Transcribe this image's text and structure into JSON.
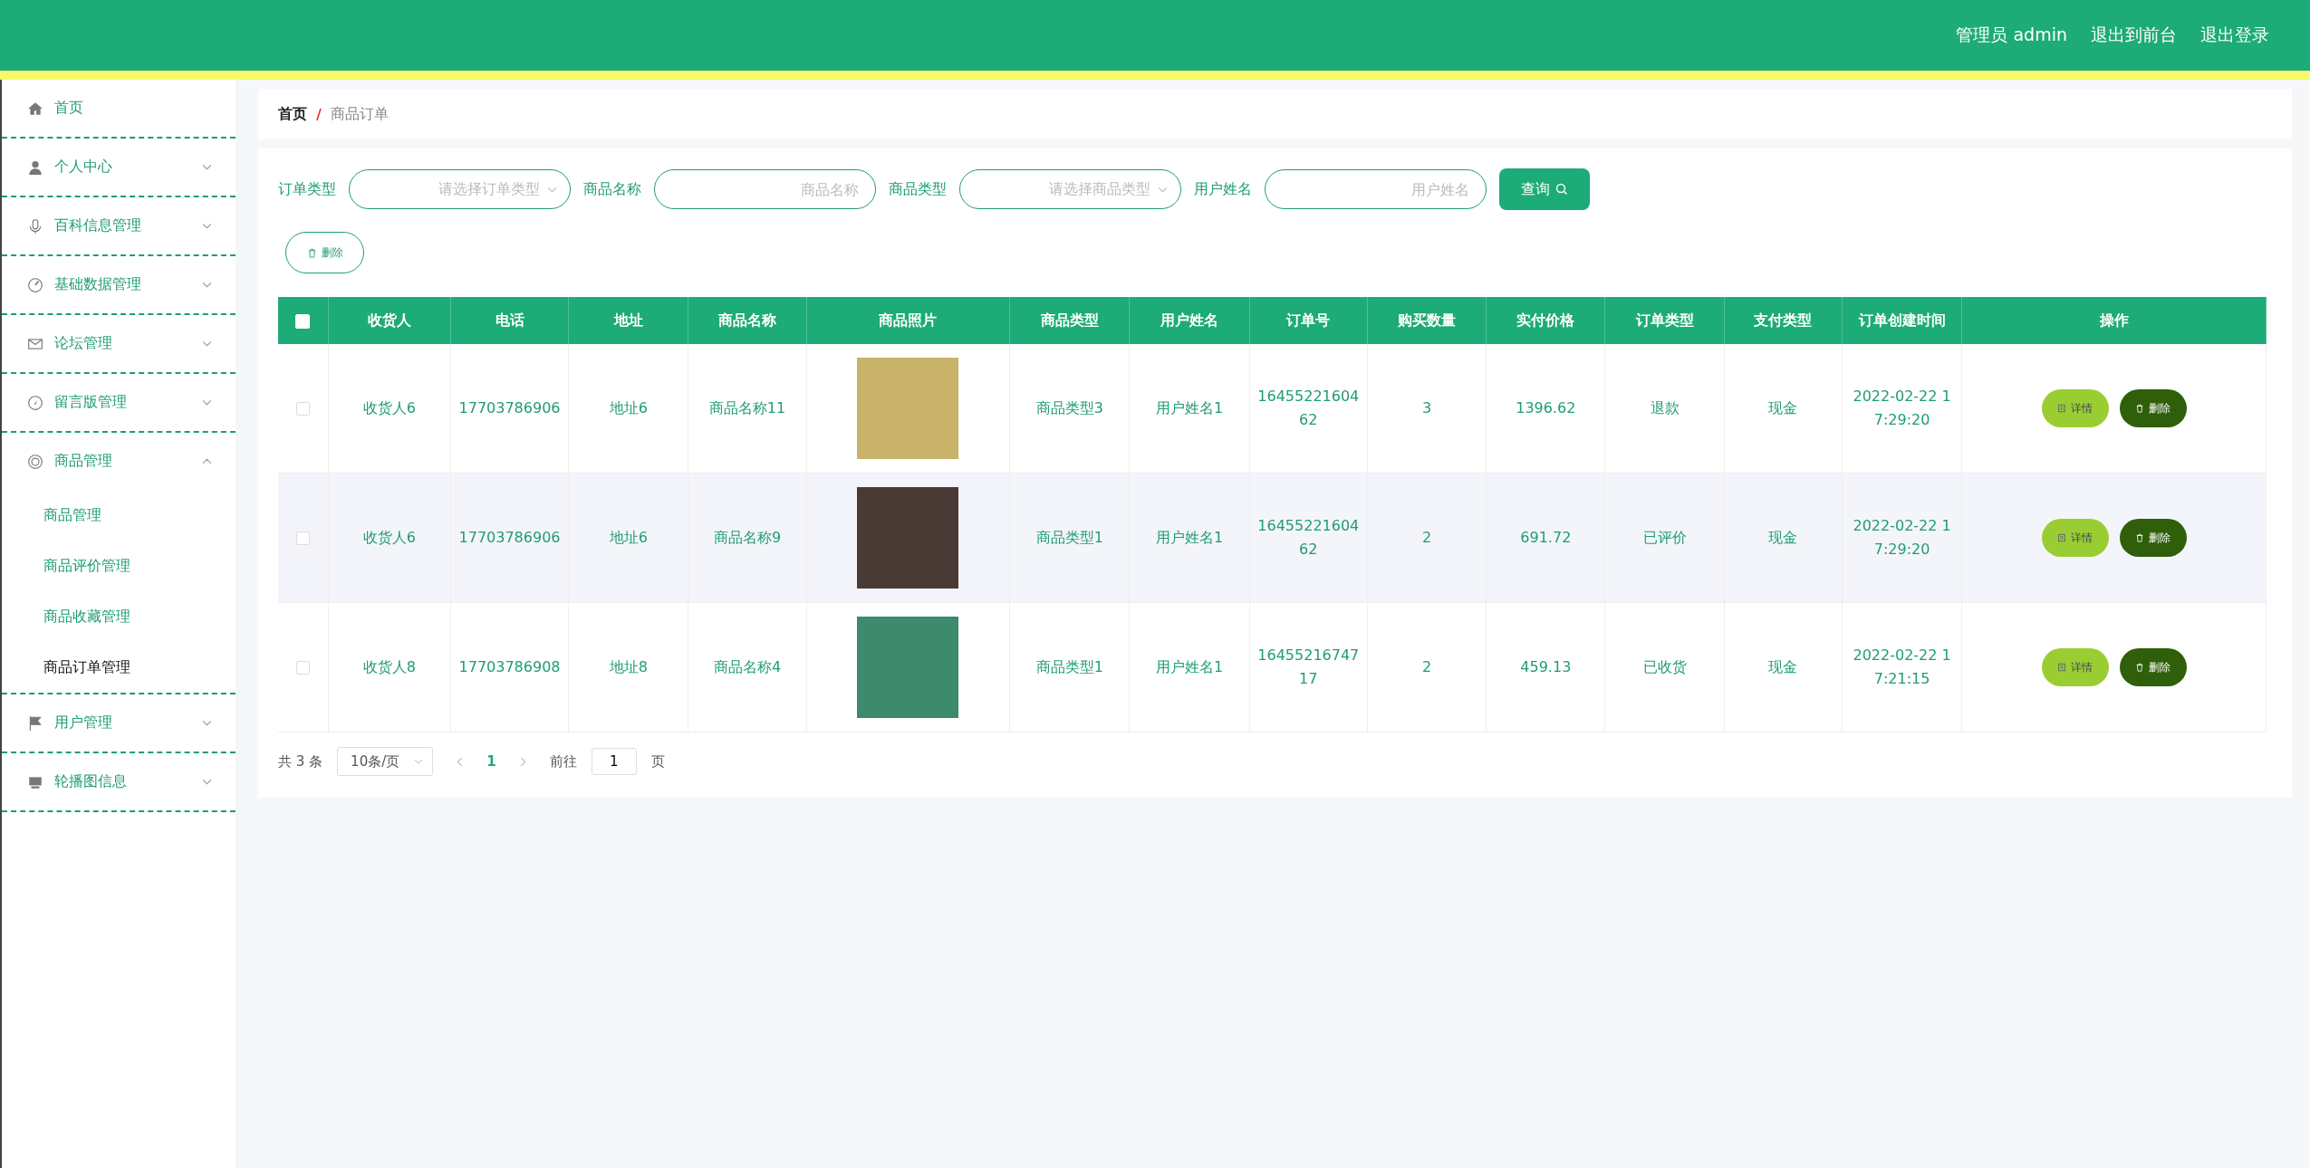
{
  "header": {
    "links": [
      "管理员 admin",
      "退出到前台",
      "退出登录"
    ]
  },
  "sidebar": {
    "items": [
      {
        "label": "首页"
      },
      {
        "label": "个人中心",
        "expanded": false
      },
      {
        "label": "百科信息管理",
        "expanded": false
      },
      {
        "label": "基础数据管理",
        "expanded": false
      },
      {
        "label": "论坛管理",
        "expanded": false
      },
      {
        "label": "留言版管理",
        "expanded": false
      },
      {
        "label": "商品管理",
        "expanded": true,
        "children": [
          {
            "label": "商品管理",
            "selected": false
          },
          {
            "label": "商品评价管理",
            "selected": false
          },
          {
            "label": "商品收藏管理",
            "selected": false
          },
          {
            "label": "商品订单管理",
            "selected": true
          }
        ]
      },
      {
        "label": "用户管理",
        "expanded": false
      },
      {
        "label": "轮播图信息",
        "expanded": false
      }
    ]
  },
  "breadcrumb": {
    "items": [
      "首页",
      "商品订单"
    ],
    "separator": "/"
  },
  "search": {
    "fields": [
      {
        "kind": "select",
        "label": "订单类型",
        "placeholder": "请选择订单类型"
      },
      {
        "kind": "input",
        "label": "商品名称",
        "placeholder": "商品名称"
      },
      {
        "kind": "select",
        "label": "商品类型",
        "placeholder": "请选择商品类型"
      },
      {
        "kind": "input",
        "label": "用户姓名",
        "placeholder": "用户姓名"
      }
    ],
    "button": "查询"
  },
  "delete_button": "删除",
  "table": {
    "select_all_checked": false,
    "columns": [
      "收货人",
      "电话",
      "地址",
      "商品名称",
      "商品照片",
      "商品类型",
      "用户姓名",
      "订单号",
      "购买数量",
      "实付价格",
      "订单类型",
      "支付类型",
      "订单创建时间",
      "操作"
    ],
    "rows": [
      {
        "checked": false,
        "cells": [
          "收货人6",
          "17703786906",
          "地址6",
          "商品名称11",
          null,
          "商品类型3",
          "用户姓名1",
          "1645522160462",
          "3",
          "1396.62",
          "退款",
          "现金",
          "2022-02-22 17:29:20"
        ],
        "actions": [
          "详情",
          "删除"
        ]
      },
      {
        "checked": false,
        "cells": [
          "收货人6",
          "17703786906",
          "地址6",
          "商品名称9",
          null,
          "商品类型1",
          "用户姓名1",
          "1645522160462",
          "2",
          "691.72",
          "已评价",
          "现金",
          "2022-02-22 17:29:20"
        ],
        "actions": [
          "详情",
          "删除"
        ]
      },
      {
        "checked": false,
        "cells": [
          "收货人8",
          "17703786908",
          "地址8",
          "商品名称4",
          null,
          "商品类型1",
          "用户姓名1",
          "1645521674717",
          "2",
          "459.13",
          "已收货",
          "现金",
          "2022-02-22 17:21:15"
        ],
        "actions": [
          "详情",
          "删除"
        ]
      }
    ]
  },
  "pagination": {
    "total": "共 3 条",
    "page_size": "10条/页",
    "pages": [
      {
        "label": "1",
        "selected": true
      }
    ],
    "goto_label": "前往",
    "goto_value": "1",
    "goto_suffix": "页"
  }
}
